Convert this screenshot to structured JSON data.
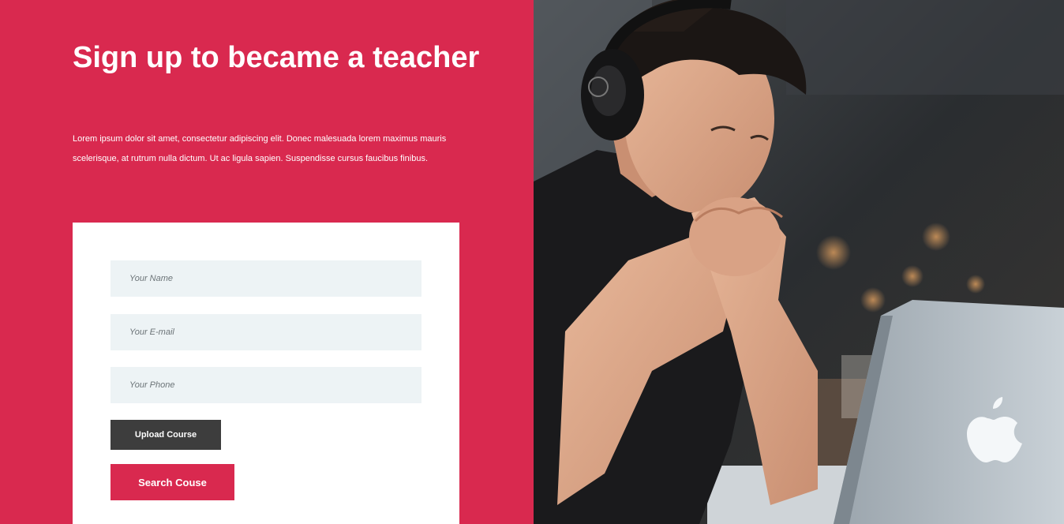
{
  "signup": {
    "title": "Sign up to became a teacher",
    "description": "Lorem ipsum dolor sit amet, consectetur adipiscing elit. Donec malesuada lorem maximus mauris scelerisque, at rutrum nulla dictum. Ut ac ligula sapien. Suspendisse cursus faucibus finibus."
  },
  "form": {
    "name_placeholder": "Your Name",
    "email_placeholder": "Your E-mail",
    "phone_placeholder": "Your Phone",
    "upload_label": "Upload Course",
    "search_label": "Search Couse"
  },
  "colors": {
    "accent": "#d9294f",
    "dark_button": "#3d3d3d",
    "field_background": "#edf3f5"
  }
}
